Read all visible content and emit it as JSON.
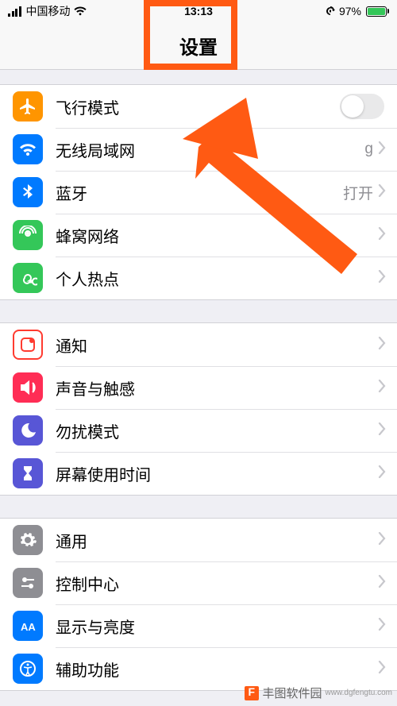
{
  "status": {
    "carrier": "中国移动",
    "time": "13:13",
    "battery_pct": "97%"
  },
  "nav": {
    "title": "设置"
  },
  "groups": [
    {
      "rows": [
        {
          "key": "airplane",
          "label": "飞行模式",
          "value": "",
          "type": "toggle"
        },
        {
          "key": "wifi",
          "label": "无线局域网",
          "value": "g",
          "type": "nav"
        },
        {
          "key": "bluetooth",
          "label": "蓝牙",
          "value": "打开",
          "type": "nav"
        },
        {
          "key": "cellular",
          "label": "蜂窝网络",
          "value": "",
          "type": "nav"
        },
        {
          "key": "hotspot",
          "label": "个人热点",
          "value": "",
          "type": "nav"
        }
      ]
    },
    {
      "rows": [
        {
          "key": "notifications",
          "label": "通知",
          "value": "",
          "type": "nav"
        },
        {
          "key": "sounds",
          "label": "声音与触感",
          "value": "",
          "type": "nav"
        },
        {
          "key": "dnd",
          "label": "勿扰模式",
          "value": "",
          "type": "nav"
        },
        {
          "key": "screentime",
          "label": "屏幕使用时间",
          "value": "",
          "type": "nav"
        }
      ]
    },
    {
      "rows": [
        {
          "key": "general",
          "label": "通用",
          "value": "",
          "type": "nav"
        },
        {
          "key": "controlcenter",
          "label": "控制中心",
          "value": "",
          "type": "nav"
        },
        {
          "key": "display",
          "label": "显示与亮度",
          "value": "",
          "type": "nav"
        },
        {
          "key": "accessibility",
          "label": "辅助功能",
          "value": "",
          "type": "nav"
        }
      ]
    }
  ],
  "watermark": {
    "name": "丰图软件园",
    "url": "www.dgfengtu.com"
  },
  "annotations": {
    "highlight": "settings-title",
    "arrow_target": "wifi-row"
  }
}
